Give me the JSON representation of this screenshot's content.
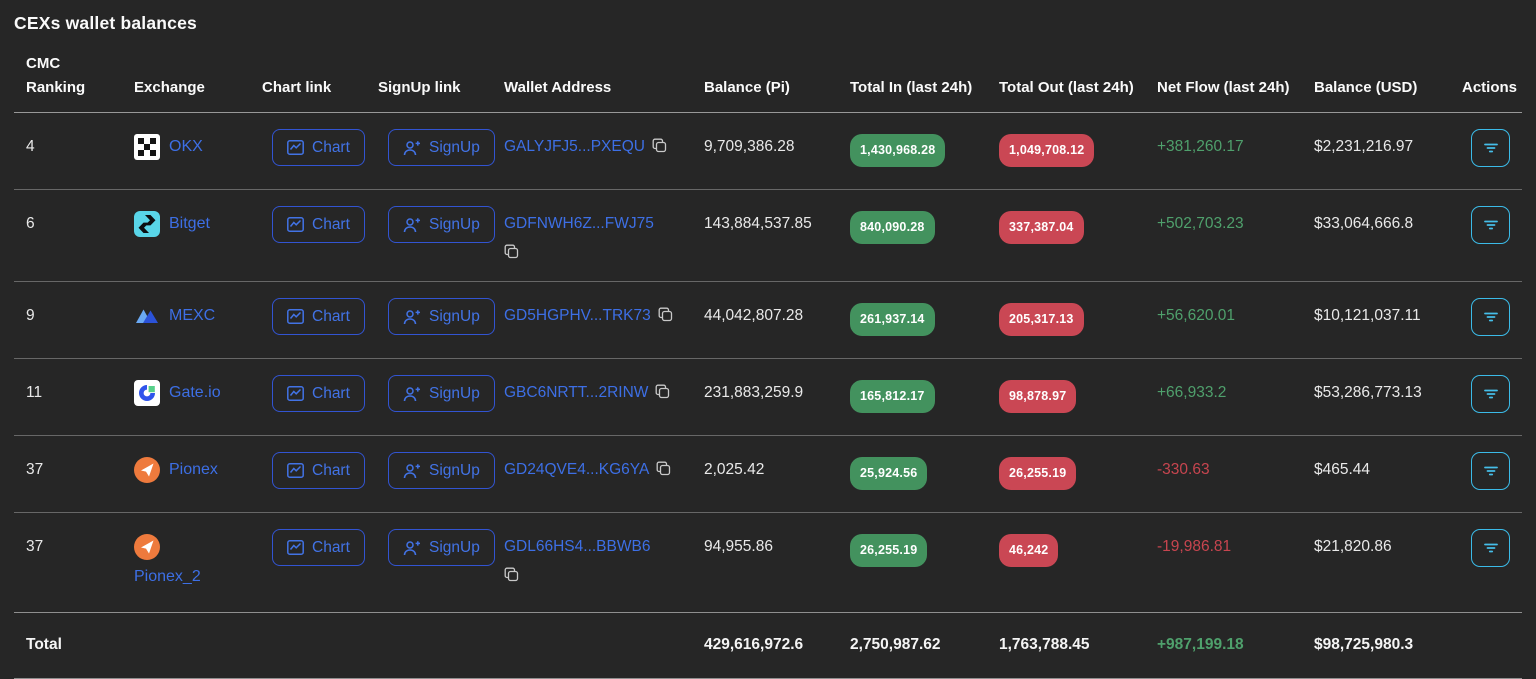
{
  "title": "CEXs wallet balances",
  "buttons": {
    "chart": "Chart",
    "signup": "SignUp"
  },
  "colors": {
    "background": "#262626",
    "link_blue": "#3d6fe5",
    "button_border_blue": "#3254d2",
    "badge_green": "#43925e",
    "badge_red": "#ca4754",
    "net_positive": "#4fa06c",
    "net_negative": "#c7454f",
    "action_cyan": "#3bbbe8"
  },
  "table": {
    "columns": [
      "CMC Ranking",
      "Exchange",
      "Chart link",
      "SignUp link",
      "Wallet Address",
      "Balance (Pi)",
      "Total In (last 24h)",
      "Total Out (last 24h)",
      "Net Flow (last 24h)",
      "Balance (USD)",
      "Actions"
    ],
    "rows": [
      {
        "ranking": "4",
        "exchange": "OKX",
        "exchange_icon": "okx-logo",
        "wallet_address": "GALYJFJ5...PXEQU",
        "balance_pi": "9,709,386.28",
        "total_in": "1,430,968.28",
        "total_out": "1,049,708.12",
        "net_flow": "+381,260.17",
        "balance_usd": "$2,231,216.97"
      },
      {
        "ranking": "6",
        "exchange": "Bitget",
        "exchange_icon": "bitget-logo",
        "wallet_address": "GDFNWH6Z...FWJ75",
        "balance_pi": "143,884,537.85",
        "total_in": "840,090.28",
        "total_out": "337,387.04",
        "net_flow": "+502,703.23",
        "balance_usd": "$33,064,666.8"
      },
      {
        "ranking": "9",
        "exchange": "MEXC",
        "exchange_icon": "mexc-logo",
        "wallet_address": "GD5HGPHV...TRK73",
        "balance_pi": "44,042,807.28",
        "total_in": "261,937.14",
        "total_out": "205,317.13",
        "net_flow": "+56,620.01",
        "balance_usd": "$10,121,037.11"
      },
      {
        "ranking": "11",
        "exchange": "Gate.io",
        "exchange_icon": "gateio-logo",
        "wallet_address": "GBC6NRTT...2RINW",
        "balance_pi": "231,883,259.9",
        "total_in": "165,812.17",
        "total_out": "98,878.97",
        "net_flow": "+66,933.2",
        "balance_usd": "$53,286,773.13"
      },
      {
        "ranking": "37",
        "exchange": "Pionex",
        "exchange_icon": "pionex-logo",
        "wallet_address": "GD24QVE4...KG6YA",
        "balance_pi": "2,025.42",
        "total_in": "25,924.56",
        "total_out": "26,255.19",
        "net_flow": "-330.63",
        "balance_usd": "$465.44"
      },
      {
        "ranking": "37",
        "exchange": "Pionex_2",
        "exchange_icon": "pionex-logo",
        "wallet_address": "GDL66HS4...BBWB6",
        "balance_pi": "94,955.86",
        "total_in": "26,255.19",
        "total_out": "46,242",
        "net_flow": "-19,986.81",
        "balance_usd": "$21,820.86"
      }
    ],
    "total": {
      "label": "Total",
      "balance_pi": "429,616,972.6",
      "total_in": "2,750,987.62",
      "total_out": "1,763,788.45",
      "net_flow": "+987,199.18",
      "balance_usd": "$98,725,980.3"
    }
  }
}
